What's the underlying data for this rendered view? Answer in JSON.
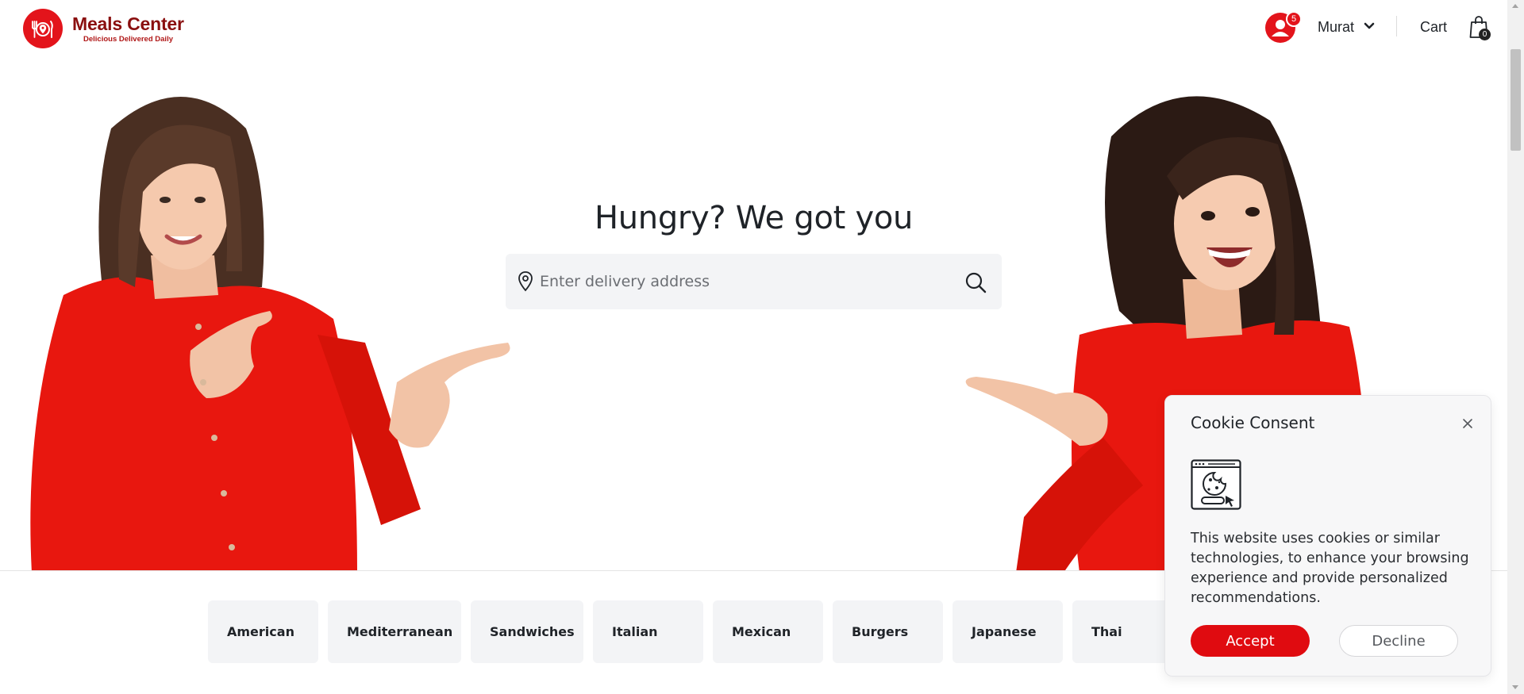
{
  "brand": {
    "name": "Meals Center",
    "tagline": "Delicious Delivered Daily",
    "logo_icon": "plate-fork-knife-pin-icon",
    "color": "#e3141b"
  },
  "header": {
    "user": {
      "avatar_icon": "user-icon",
      "notification_count": "5",
      "name": "Murat",
      "menu_icon": "chevron-down-icon"
    },
    "cart": {
      "label": "Cart",
      "icon": "shopping-bag-icon",
      "count": "0"
    }
  },
  "hero": {
    "title": "Hungry? We got you",
    "search": {
      "placeholder": "Enter delivery address",
      "value": "",
      "leading_icon": "location-pin-icon",
      "button_icon": "search-icon"
    }
  },
  "categories": [
    {
      "label": "American"
    },
    {
      "label": "Mediterranean"
    },
    {
      "label": "Sandwiches"
    },
    {
      "label": "Italian"
    },
    {
      "label": "Mexican"
    },
    {
      "label": "Burgers"
    },
    {
      "label": "Japanese"
    },
    {
      "label": "Thai"
    }
  ],
  "cookie_consent": {
    "title": "Cookie Consent",
    "icon": "cookie-browser-icon",
    "close_icon": "close-icon",
    "message": "This website uses cookies or similar technologies, to enhance your browsing experience and provide personalized recommendations.",
    "accept_label": "Accept",
    "decline_label": "Decline",
    "accent_color": "#e00b10"
  }
}
